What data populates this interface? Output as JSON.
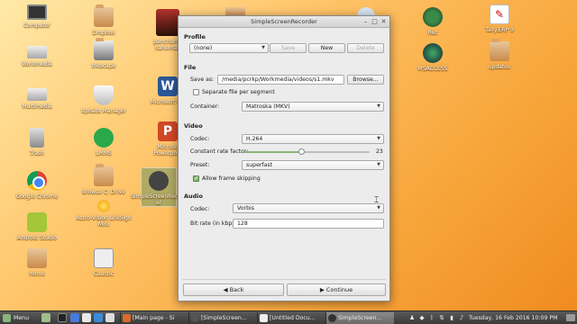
{
  "desktop": {
    "icons": [
      {
        "label": "Computer",
        "icon": "monitor-icon"
      },
      {
        "label": "Workmedia",
        "icon": "drive-icon"
      },
      {
        "label": "Multimedia",
        "icon": "drive-icon"
      },
      {
        "label": "Trash",
        "icon": "trash-icon"
      },
      {
        "label": "Google Chrome",
        "icon": "chrome-icon"
      },
      {
        "label": "Android Studio",
        "icon": "android-icon"
      },
      {
        "label": "Home",
        "icon": "home-folder-icon"
      },
      {
        "label": "Dropbox",
        "icon": "folder-icon"
      },
      {
        "label": "Inkscape",
        "icon": "inkscape-icon"
      },
      {
        "label": "Update Manager",
        "icon": "shield-icon"
      },
      {
        "label": "LMMS",
        "icon": "lmms-icon"
      },
      {
        "label": "Browse C: Drive",
        "icon": "folder-icon"
      },
      {
        "label": "Astro-Vision LifeSign Mini",
        "icon": "sun-icon"
      },
      {
        "label": "Caustic",
        "icon": "caustic-icon"
      },
      {
        "label": "panchamu\nhanuman",
        "icon": "deity-image-icon"
      },
      {
        "label": "Microsoft Wo",
        "icon": "word-icon"
      },
      {
        "label": "Microso\nPowerpoin",
        "icon": "powerpoint-icon"
      },
      {
        "label": "SimpleScreenRecord\ner",
        "icon": "ssr-icon"
      },
      {
        "label": "Rec",
        "icon": "rec-icon"
      },
      {
        "label": "MSACCESS",
        "icon": "msaccess-icon"
      },
      {
        "label": "Tally.ERP 9",
        "icon": "tally-icon"
      },
      {
        "label": "updates",
        "icon": "folder-icon"
      }
    ]
  },
  "window": {
    "title": "SimpleScreenRecorder",
    "profile": {
      "section": "Profile",
      "selected": "(none)",
      "save_label": "Save",
      "new_label": "New",
      "delete_label": "Delete"
    },
    "file": {
      "section": "File",
      "save_as_label": "Save as:",
      "save_as_value": "/media/pcrkp/Workmedia/videos/s1.mkv",
      "browse_label": "Browse...",
      "separate_label": "Separate file per segment",
      "separate_checked": false,
      "container_label": "Container:",
      "container_value": "Matroska (MKV)"
    },
    "video": {
      "section": "Video",
      "codec_label": "Codec:",
      "codec_value": "H.264",
      "crf_label": "Constant rate factor:",
      "crf_value": "23",
      "crf_fraction": 0.46,
      "preset_label": "Preset:",
      "preset_value": "superfast",
      "frame_skip_label": "Allow frame skipping",
      "frame_skip_checked": true
    },
    "audio": {
      "section": "Audio",
      "codec_label": "Codec:",
      "codec_value": "Vorbis",
      "bitrate_label": "Bit rate (in kbps):",
      "bitrate_value": "128"
    },
    "back_label": "Back",
    "continue_label": "Continue"
  },
  "taskbar": {
    "menu_label": "Menu",
    "windows": [
      {
        "label": "[Main page - Si",
        "active": false
      },
      {
        "label": "[SimpleScreen...",
        "active": false
      },
      {
        "label": "[Untitled Docu...",
        "active": false
      },
      {
        "label": "SimpleScreen...",
        "active": true
      }
    ],
    "clock": "Tuesday, 16 Feb 2016 10:09 PM"
  },
  "colors": {
    "accent": "#8ab47a",
    "desktop_top": "#ffe9a8",
    "desktop_bottom": "#ef8a1f",
    "taskbar": "#3a3a3a"
  }
}
